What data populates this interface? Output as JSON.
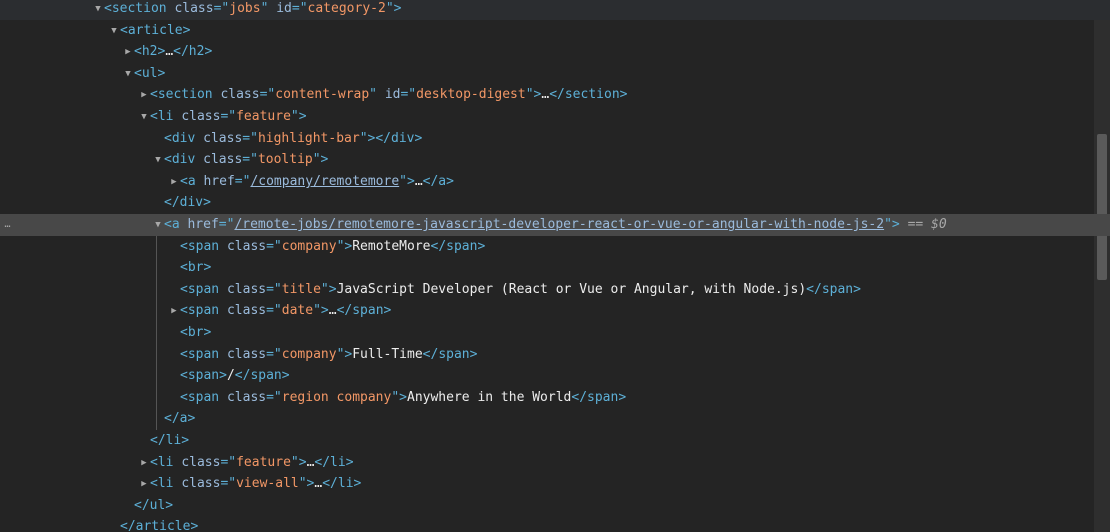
{
  "dollar_zero": "== $0",
  "row_menu": "…",
  "rows": [
    {
      "tri": "down",
      "parts": [
        {
          "t": "tag",
          "v": "<section"
        },
        {
          "t": "txt",
          "v": " "
        },
        {
          "t": "attr",
          "v": "class"
        },
        {
          "t": "tag",
          "v": "=\""
        },
        {
          "t": "val",
          "v": "jobs"
        },
        {
          "t": "tag",
          "v": "\""
        },
        {
          "t": "txt",
          "v": " "
        },
        {
          "t": "attr",
          "v": "id"
        },
        {
          "t": "tag",
          "v": "=\""
        },
        {
          "t": "val",
          "v": "category-2"
        },
        {
          "t": "tag",
          "v": "\">"
        }
      ]
    },
    {
      "tri": "down",
      "parts": [
        {
          "t": "tag",
          "v": "<article>"
        }
      ]
    },
    {
      "tri": "right",
      "parts": [
        {
          "t": "tag",
          "v": "<h2>"
        },
        {
          "t": "txt",
          "v": "…"
        },
        {
          "t": "tag",
          "v": "</h2>"
        }
      ]
    },
    {
      "tri": "down",
      "parts": [
        {
          "t": "tag",
          "v": "<ul>"
        }
      ]
    },
    {
      "tri": "right",
      "parts": [
        {
          "t": "tag",
          "v": "<section"
        },
        {
          "t": "txt",
          "v": " "
        },
        {
          "t": "attr",
          "v": "class"
        },
        {
          "t": "tag",
          "v": "=\""
        },
        {
          "t": "val",
          "v": "content-wrap"
        },
        {
          "t": "tag",
          "v": "\""
        },
        {
          "t": "txt",
          "v": " "
        },
        {
          "t": "attr",
          "v": "id"
        },
        {
          "t": "tag",
          "v": "=\""
        },
        {
          "t": "val",
          "v": "desktop-digest"
        },
        {
          "t": "tag",
          "v": "\">"
        },
        {
          "t": "txt",
          "v": "…"
        },
        {
          "t": "tag",
          "v": "</section>"
        }
      ]
    },
    {
      "tri": "down",
      "parts": [
        {
          "t": "tag",
          "v": "<li"
        },
        {
          "t": "txt",
          "v": " "
        },
        {
          "t": "attr",
          "v": "class"
        },
        {
          "t": "tag",
          "v": "=\""
        },
        {
          "t": "val",
          "v": "feature"
        },
        {
          "t": "tag",
          "v": "\">"
        }
      ]
    },
    {
      "tri": "none",
      "parts": [
        {
          "t": "tag",
          "v": "<div"
        },
        {
          "t": "txt",
          "v": " "
        },
        {
          "t": "attr",
          "v": "class"
        },
        {
          "t": "tag",
          "v": "=\""
        },
        {
          "t": "val",
          "v": "highlight-bar"
        },
        {
          "t": "tag",
          "v": "\">"
        },
        {
          "t": "tag",
          "v": "</div>"
        }
      ]
    },
    {
      "tri": "down",
      "parts": [
        {
          "t": "tag",
          "v": "<div"
        },
        {
          "t": "txt",
          "v": " "
        },
        {
          "t": "attr",
          "v": "class"
        },
        {
          "t": "tag",
          "v": "=\""
        },
        {
          "t": "val",
          "v": "tooltip"
        },
        {
          "t": "tag",
          "v": "\">"
        }
      ]
    },
    {
      "tri": "right",
      "parts": [
        {
          "t": "tag",
          "v": "<a"
        },
        {
          "t": "txt",
          "v": " "
        },
        {
          "t": "attr",
          "v": "href"
        },
        {
          "t": "tag",
          "v": "=\""
        },
        {
          "t": "link",
          "v": "/company/remotemore"
        },
        {
          "t": "tag",
          "v": "\">"
        },
        {
          "t": "txt",
          "v": "…"
        },
        {
          "t": "tag",
          "v": "</a>"
        }
      ]
    },
    {
      "tri": "none",
      "parts": [
        {
          "t": "tag",
          "v": "</div>"
        }
      ]
    },
    {
      "tri": "down",
      "selected": true,
      "parts": [
        {
          "t": "tag",
          "v": "<a"
        },
        {
          "t": "txt",
          "v": " "
        },
        {
          "t": "attr",
          "v": "href"
        },
        {
          "t": "tag",
          "v": "=\""
        },
        {
          "t": "link",
          "v": "/remote-jobs/remotemore-javascript-developer-react-or-vue-or-angular-with-node-js-2"
        },
        {
          "t": "tag",
          "v": "\">"
        }
      ]
    },
    {
      "tri": "none",
      "parts": [
        {
          "t": "tag",
          "v": "<span"
        },
        {
          "t": "txt",
          "v": " "
        },
        {
          "t": "attr",
          "v": "class"
        },
        {
          "t": "tag",
          "v": "=\""
        },
        {
          "t": "val",
          "v": "company"
        },
        {
          "t": "tag",
          "v": "\">"
        },
        {
          "t": "txt",
          "v": "RemoteMore"
        },
        {
          "t": "tag",
          "v": "</span>"
        }
      ]
    },
    {
      "tri": "none",
      "parts": [
        {
          "t": "tag",
          "v": "<br>"
        }
      ]
    },
    {
      "tri": "none",
      "parts": [
        {
          "t": "tag",
          "v": "<span"
        },
        {
          "t": "txt",
          "v": " "
        },
        {
          "t": "attr",
          "v": "class"
        },
        {
          "t": "tag",
          "v": "=\""
        },
        {
          "t": "val",
          "v": "title"
        },
        {
          "t": "tag",
          "v": "\">"
        },
        {
          "t": "txt",
          "v": "JavaScript Developer (React or Vue or Angular, with Node.js)"
        },
        {
          "t": "tag",
          "v": "</span>"
        }
      ]
    },
    {
      "tri": "right",
      "parts": [
        {
          "t": "tag",
          "v": "<span"
        },
        {
          "t": "txt",
          "v": " "
        },
        {
          "t": "attr",
          "v": "class"
        },
        {
          "t": "tag",
          "v": "=\""
        },
        {
          "t": "val",
          "v": "date"
        },
        {
          "t": "tag",
          "v": "\">"
        },
        {
          "t": "txt",
          "v": "…"
        },
        {
          "t": "tag",
          "v": "</span>"
        }
      ]
    },
    {
      "tri": "none",
      "parts": [
        {
          "t": "tag",
          "v": "<br>"
        }
      ]
    },
    {
      "tri": "none",
      "parts": [
        {
          "t": "tag",
          "v": "<span"
        },
        {
          "t": "txt",
          "v": " "
        },
        {
          "t": "attr",
          "v": "class"
        },
        {
          "t": "tag",
          "v": "=\""
        },
        {
          "t": "val",
          "v": "company"
        },
        {
          "t": "tag",
          "v": "\">"
        },
        {
          "t": "txt",
          "v": "Full-Time"
        },
        {
          "t": "tag",
          "v": "</span>"
        }
      ]
    },
    {
      "tri": "none",
      "parts": [
        {
          "t": "tag",
          "v": "<span>"
        },
        {
          "t": "txt",
          "v": "/"
        },
        {
          "t": "tag",
          "v": "</span>"
        }
      ]
    },
    {
      "tri": "none",
      "parts": [
        {
          "t": "tag",
          "v": "<span"
        },
        {
          "t": "txt",
          "v": " "
        },
        {
          "t": "attr",
          "v": "class"
        },
        {
          "t": "tag",
          "v": "=\""
        },
        {
          "t": "val",
          "v": "region company"
        },
        {
          "t": "tag",
          "v": "\">"
        },
        {
          "t": "txt",
          "v": "Anywhere in the World"
        },
        {
          "t": "tag",
          "v": "</span>"
        }
      ]
    },
    {
      "tri": "none",
      "parts": [
        {
          "t": "tag",
          "v": "</a>"
        }
      ]
    },
    {
      "tri": "none",
      "parts": [
        {
          "t": "tag",
          "v": "</li>"
        }
      ]
    },
    {
      "tri": "right",
      "parts": [
        {
          "t": "tag",
          "v": "<li"
        },
        {
          "t": "txt",
          "v": " "
        },
        {
          "t": "attr",
          "v": "class"
        },
        {
          "t": "tag",
          "v": "=\""
        },
        {
          "t": "val",
          "v": "feature"
        },
        {
          "t": "tag",
          "v": "\">"
        },
        {
          "t": "txt",
          "v": "…"
        },
        {
          "t": "tag",
          "v": "</li>"
        }
      ]
    },
    {
      "tri": "right",
      "parts": [
        {
          "t": "tag",
          "v": "<li"
        },
        {
          "t": "txt",
          "v": " "
        },
        {
          "t": "attr",
          "v": "class"
        },
        {
          "t": "tag",
          "v": "=\""
        },
        {
          "t": "val",
          "v": "view-all"
        },
        {
          "t": "tag",
          "v": "\">"
        },
        {
          "t": "txt",
          "v": "…"
        },
        {
          "t": "tag",
          "v": "</li>"
        }
      ]
    },
    {
      "tri": "none",
      "parts": [
        {
          "t": "tag",
          "v": "</ul>"
        }
      ]
    },
    {
      "tri": "none",
      "parts": [
        {
          "t": "tag",
          "v": "</article>"
        }
      ]
    }
  ]
}
